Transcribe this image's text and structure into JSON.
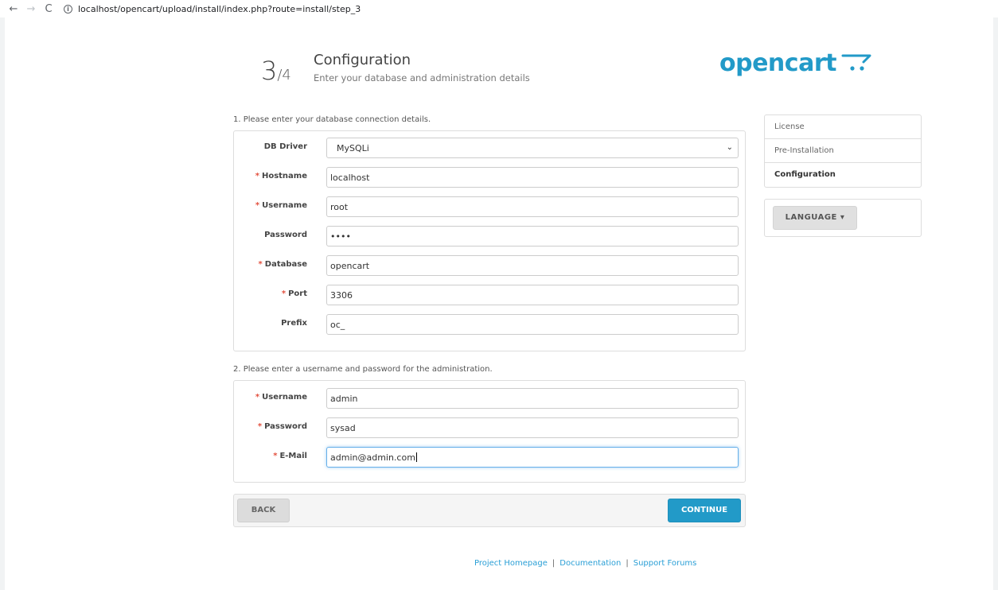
{
  "browser": {
    "back_icon": "←",
    "forward_icon": "→",
    "reload_icon": "C",
    "info_icon": "i",
    "url": "localhost/opencart/upload/install/index.php?route=install/step_3"
  },
  "header": {
    "step": "3",
    "step_total": "/4",
    "title": "Configuration",
    "subtitle": "Enter your database and administration details",
    "logo_text": "opencart",
    "logo_color": "#229ac8"
  },
  "db_section": {
    "label": "1. Please enter your database connection details.",
    "fields": [
      {
        "label": "DB Driver",
        "required": false,
        "value": "MySQLi",
        "type": "select"
      },
      {
        "label": "Hostname",
        "required": true,
        "value": "localhost"
      },
      {
        "label": "Username",
        "required": true,
        "value": "root"
      },
      {
        "label": "Password",
        "required": false,
        "value": "••••"
      },
      {
        "label": "Database",
        "required": true,
        "value": "opencart"
      },
      {
        "label": "Port",
        "required": true,
        "value": "3306"
      },
      {
        "label": "Prefix",
        "required": false,
        "value": "oc_"
      }
    ]
  },
  "admin_section": {
    "label": "2. Please enter a username and password for the administration.",
    "fields": [
      {
        "label": "Username",
        "required": true,
        "value": "admin"
      },
      {
        "label": "Password",
        "required": true,
        "value": "sysad"
      },
      {
        "label": "E-Mail",
        "required": true,
        "value": "admin@admin.com"
      }
    ]
  },
  "required_mark": "*",
  "select_arrow": "⌄",
  "sidebar": {
    "items": [
      {
        "label": "License"
      },
      {
        "label": "Pre-Installation"
      },
      {
        "label": "Configuration"
      }
    ],
    "language_button": "LANGUAGE ▾"
  },
  "buttons": {
    "back": "BACK",
    "continue": "CONTINUE"
  },
  "footer": {
    "links": [
      "Project Homepage",
      "Documentation",
      "Support Forums"
    ],
    "separator": "|"
  }
}
